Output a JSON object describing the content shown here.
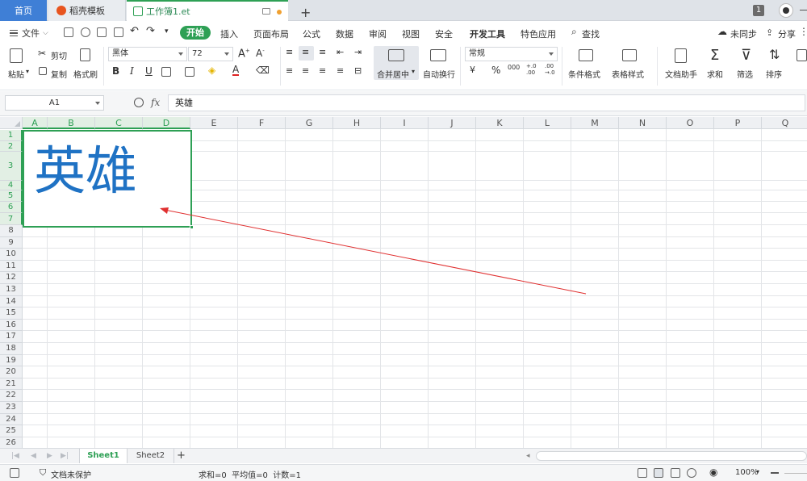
{
  "tabs": {
    "home": "首页",
    "template": "稻壳模板",
    "workbook": "工作簿1.et",
    "window_count": "1"
  },
  "menu": {
    "file": "文件",
    "start": "开始",
    "items": [
      "插入",
      "页面布局",
      "公式",
      "数据",
      "审阅",
      "视图",
      "安全",
      "开发工具",
      "特色应用"
    ],
    "search": "查找",
    "sync": "未同步",
    "share": "分享"
  },
  "ribbon": {
    "paste": "粘贴",
    "cut": "剪切",
    "copy": "复制",
    "format_painter": "格式刷",
    "font_name": "黑体",
    "font_size": "72",
    "bold": "B",
    "italic": "I",
    "underline": "U",
    "merge_center": "合并居中",
    "wrap_text": "自动换行",
    "number_format": "常规",
    "conditional_format": "条件格式",
    "table_style": "表格样式",
    "doc_helper": "文档助手",
    "sum": "求和",
    "filter": "筛选",
    "sort": "排序"
  },
  "formula_bar": {
    "name_box": "A1",
    "fx": "fx",
    "content": "英雄"
  },
  "grid": {
    "columns": [
      "A",
      "B",
      "C",
      "D",
      "E",
      "F",
      "G",
      "H",
      "I",
      "J",
      "K",
      "L",
      "M",
      "N",
      "O",
      "P",
      "Q"
    ],
    "rows": [
      "1",
      "2",
      "3",
      "4",
      "5",
      "6",
      "7",
      "8",
      "9",
      "10",
      "11",
      "12",
      "13",
      "14",
      "15",
      "16",
      "17",
      "18",
      "19",
      "20",
      "21",
      "22",
      "23",
      "24",
      "25",
      "26"
    ],
    "merged_cell_text": "英雄",
    "text_color": "#1f72c4",
    "selection_color": "#2ea055",
    "annotation_arrow_color": "#e03030"
  },
  "sheets": {
    "active": "Sheet1",
    "other": "Sheet2",
    "add": "+"
  },
  "status": {
    "protection": "文档未保护",
    "stats": "求和=0  平均值=0  计数=1",
    "zoom": "100%"
  }
}
